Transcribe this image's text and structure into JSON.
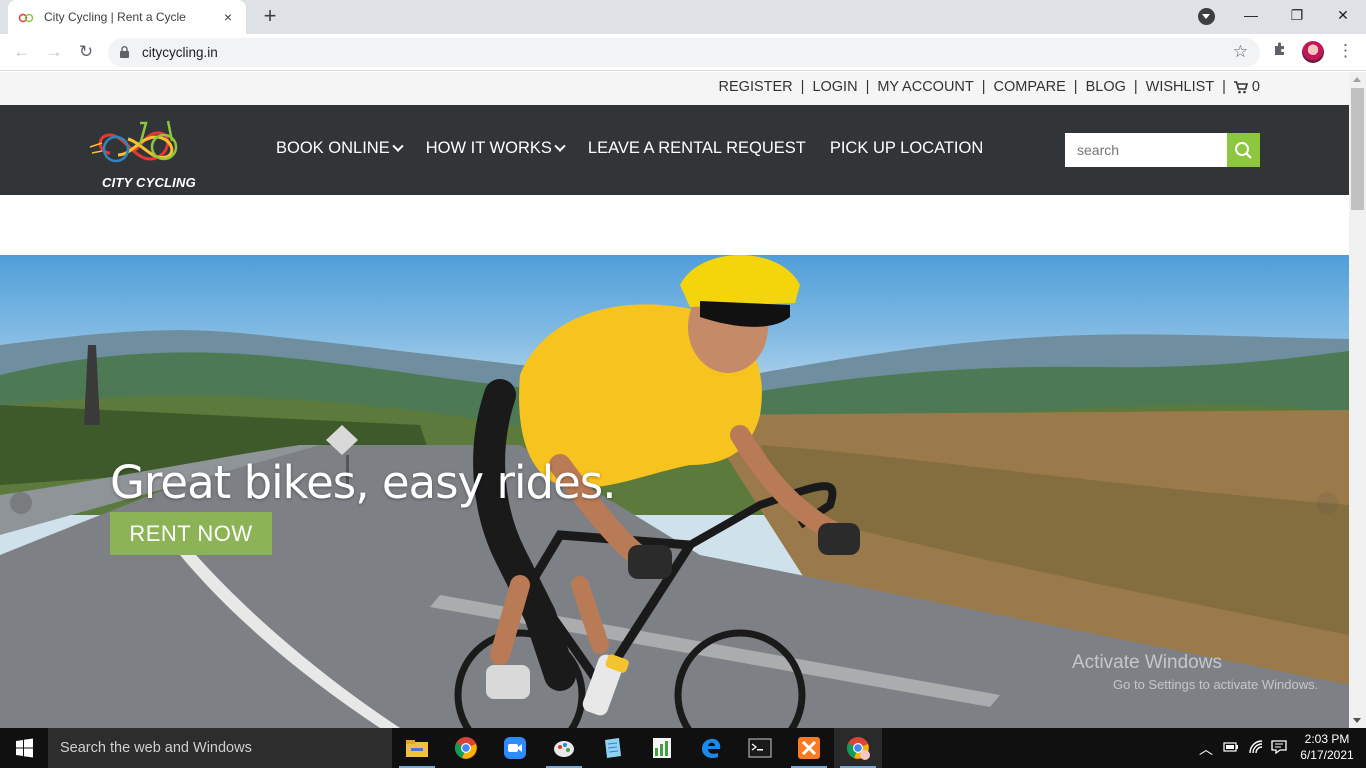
{
  "browser": {
    "tab_title": "City Cycling | Rent a Cycle",
    "url": "citycycling.in",
    "close_tab": "×",
    "new_tab": "+",
    "minimize": "—",
    "restore": "❐",
    "close_window": "✕"
  },
  "site": {
    "top_links": [
      "REGISTER",
      "LOGIN",
      "MY ACCOUNT",
      "COMPARE",
      "BLOG",
      "WISHLIST"
    ],
    "separator": "|",
    "cart_count": "0",
    "logo_text": "CITY CYCLING",
    "nav": [
      {
        "label": "BOOK ONLINE",
        "has_dropdown": true
      },
      {
        "label": "HOW IT WORKS",
        "has_dropdown": true
      },
      {
        "label": "LEAVE A RENTAL REQUEST",
        "has_dropdown": false
      },
      {
        "label": "PICK UP LOCATION",
        "has_dropdown": false
      }
    ],
    "search_placeholder": "search",
    "hero": {
      "headline": "Great bikes, easy rides.",
      "cta": "RENT NOW"
    },
    "accent_color": "#8dc63f",
    "nav_bg_color": "#313538"
  },
  "os": {
    "watermark_title": "Activate Windows",
    "watermark_sub": "Go to Settings to activate Windows.",
    "taskbar_search": "Search the web and Windows",
    "time": "2:03 PM",
    "date": "6/17/2021",
    "taskbar_apps": [
      "file-explorer-icon",
      "chrome-icon",
      "zoom-icon",
      "paint-icon",
      "notepad-icon",
      "spreadsheet-icon",
      "edge-icon",
      "terminal-icon",
      "xampp-icon",
      "chrome-profile-icon"
    ]
  }
}
